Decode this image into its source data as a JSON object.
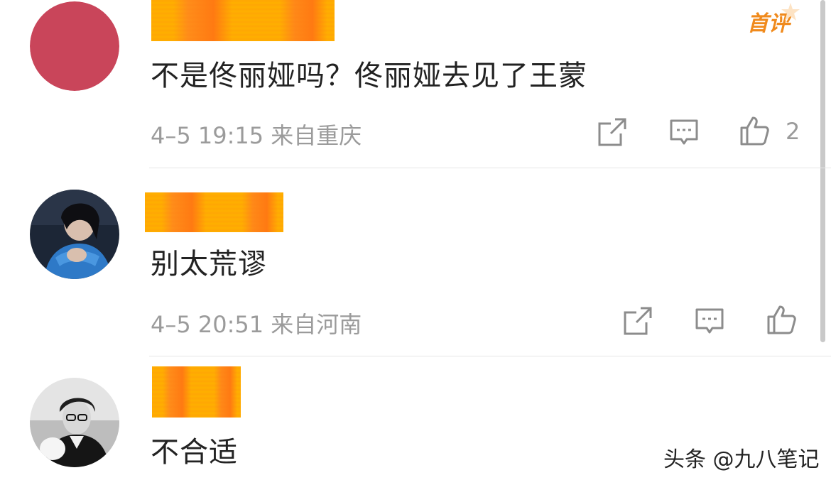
{
  "comments": [
    {
      "text": "不是佟丽娅吗？佟丽娅去见了王蒙",
      "meta": "4–5 19:15  来自重庆",
      "likes": "2",
      "badge": "首评",
      "avatar": "avatar-solid-red"
    },
    {
      "text": "别太荒谬",
      "meta": "4–5 20:51  来自河南",
      "avatar": "avatar-photo-woman"
    },
    {
      "text": "不合适",
      "avatar": "avatar-photo-man"
    }
  ],
  "icons": [
    "share-icon",
    "reply-icon",
    "like-icon"
  ],
  "colors": {
    "accent_orange": "#f08a1c",
    "redaction": "#ffb000",
    "meta_gray": "#9b9b9b",
    "text": "#222222",
    "avatar_red": "#c9455a"
  },
  "watermark": "头条 @九八笔记"
}
